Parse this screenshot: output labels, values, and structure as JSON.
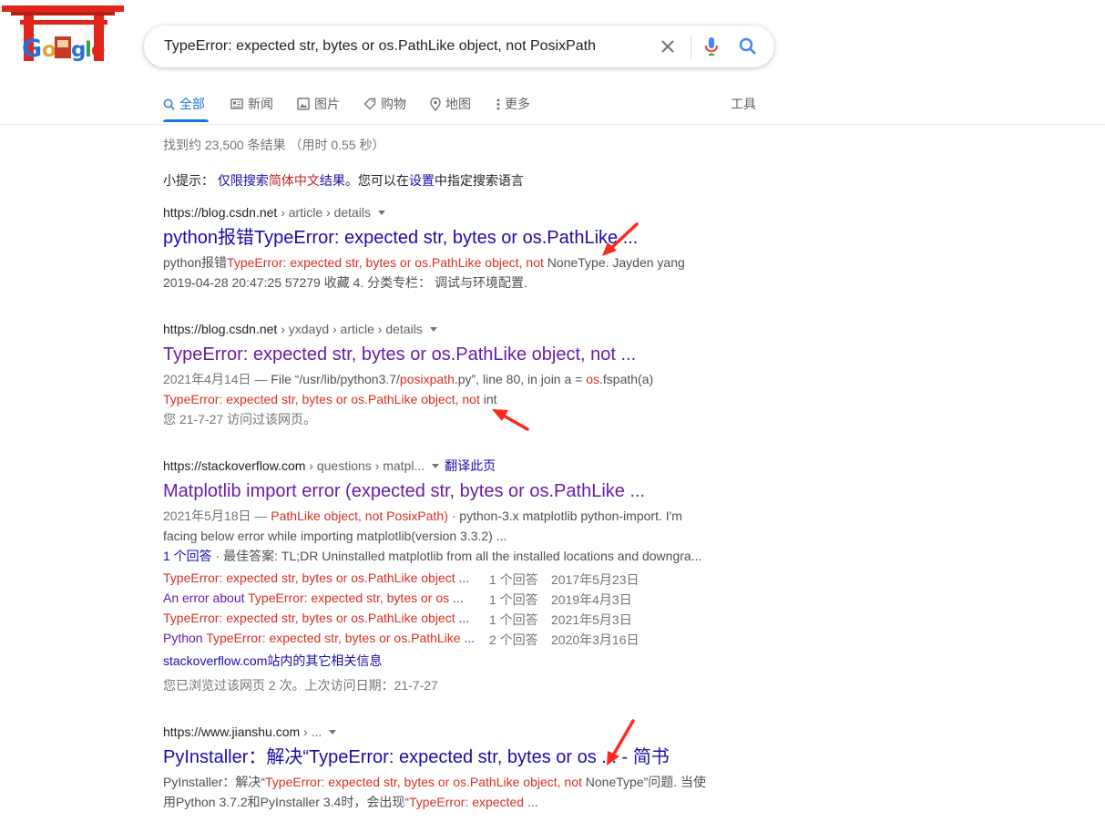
{
  "logo": {
    "alt": "Google"
  },
  "search": {
    "query": "TypeError: expected str, bytes or os.PathLike object, not PosixPath"
  },
  "tabs": {
    "all": "全部",
    "news": "新闻",
    "images": "图片",
    "shopping": "购物",
    "maps": "地图",
    "more": "更多",
    "tools": "工具"
  },
  "stats": "找到约 23,500 条结果 （用时 0.55 秒）",
  "hint": {
    "prefix": "小提示：",
    "link_a": "仅限搜索",
    "link_b": "简体中文",
    "link_c": "结果",
    "mid": "。您可以在",
    "settings": "设置",
    "suffix": "中指定搜索语言"
  },
  "results": [
    {
      "domain": "https://blog.csdn.net",
      "crumbs": " › article › details",
      "title": "python报错TypeError: expected str, bytes or os.PathLike ...",
      "line1_a": "python报错",
      "line1_em": "TypeError: expected str, bytes or os.PathLike object, not",
      "line1_b": " NoneType. Jayden yang",
      "line2": "2019-04-28 20:47:25 57279 收藏 4. 分类专栏： 调试与环境配置."
    },
    {
      "domain": "https://blog.csdn.net",
      "crumbs": " › yxdayd › article › details",
      "title": "TypeError: expected str, bytes or os.PathLike object, not ...",
      "date": "2021年4月14日 — ",
      "line1_a": "File “/usr/lib/python3.7/",
      "line1_em": "posixpath",
      "line1_b": ".py”, line 80, in join a = ",
      "line1_em2": "os",
      "line1_c": ".fspath(a)",
      "line2_em": "TypeError: expected str, bytes or os.PathLike object, not",
      "line2_b": " int",
      "visited": "您 21-7-27 访问过该网页。"
    },
    {
      "domain": "https://stackoverflow.com",
      "crumbs": " › questions › matpl...",
      "translate": "翻译此页",
      "title": "Matplotlib import error (expected str, bytes or os.PathLike ...",
      "date": "2021年5月18日 — ",
      "line1_em": "PathLike object, not PosixPath)",
      "line1_b": " · python-3.x matplotlib python-import. I'm",
      "line2": "facing below error while importing matplotlib(version 3.3.2) ...",
      "answers_link": "1 个回答",
      "answers_rest": " · 最佳答案: TL;DR Uninstalled matplotlib from all the installed locations and downgra...",
      "sublinks": [
        {
          "prefix": "",
          "em": "TypeError: expected str, bytes or os.PathLike object",
          "suffix": " ...",
          "count": "1 个回答",
          "date": "2017年5月23日"
        },
        {
          "prefix": "An error about ",
          "em": "TypeError: expected str, bytes or os",
          "suffix": " ...",
          "count": "1 个回答",
          "date": "2019年4月3日"
        },
        {
          "prefix": "",
          "em": "TypeError: expected str, bytes or os.PathLike object",
          "suffix": " ...",
          "count": "1 个回答",
          "date": "2021年5月3日"
        },
        {
          "prefix": "Python ",
          "em": "TypeError: expected str, bytes or os.PathLike",
          "suffix": " ...",
          "count": "2 个回答",
          "date": "2020年3月16日"
        }
      ],
      "more": "stackoverflow.com站内的其它相关信息",
      "visited": "您已浏览过该网页 2 次。上次访问日期：21-7-27"
    },
    {
      "domain": "https://www.jianshu.com",
      "crumbs": " › ...",
      "title": "PyInstaller：解决“TypeError: expected str, bytes or os ... - 简书",
      "line1_a": "PyInstaller：解决“",
      "line1_em": "TypeError: expected str, bytes or os.PathLike object, not",
      "line1_b": " NoneType”问题. 当使",
      "line2_a": "用Python 3.7.2和PyInstaller 3.4时，会出现“",
      "line2_em": "TypeError: expected",
      "line2_b": " ..."
    }
  ],
  "colors": {
    "link": "#1a0dab",
    "visited": "#681da8",
    "emphasis": "#d93025",
    "accent": "#1a73e8",
    "annotation_arrow": "#ff2a1a"
  }
}
